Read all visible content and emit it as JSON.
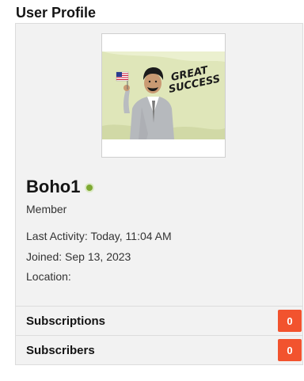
{
  "widget": {
    "title": "User Profile"
  },
  "profile": {
    "avatar_banner_text": "GREAT SUCCESS",
    "username": "Boho1",
    "status": "online",
    "role": "Member",
    "last_activity_label": "Last Activity:",
    "last_activity_value": "Today, 11:04 AM",
    "joined_label": "Joined:",
    "joined_value": "Sep 13, 2023",
    "location_label": "Location:",
    "location_value": ""
  },
  "stats": [
    {
      "label": "Subscriptions",
      "count": "0"
    },
    {
      "label": "Subscribers",
      "count": "0"
    }
  ],
  "colors": {
    "badge": "#f2532e",
    "online": "#7ea933",
    "card_bg": "#f2f2f2",
    "border": "#dcdcdc"
  }
}
